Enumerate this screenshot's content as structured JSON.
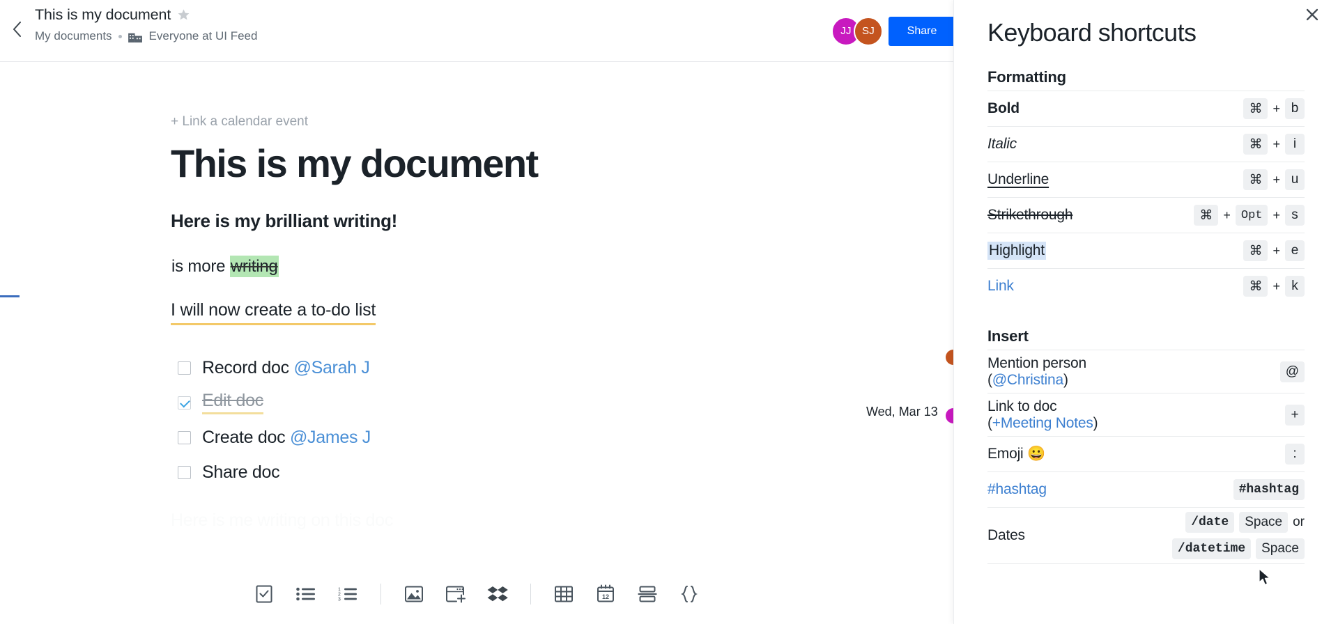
{
  "header": {
    "back_icon": "chevron-left-icon",
    "doc_title": "This is my document",
    "star_icon": "star-icon",
    "breadcrumb_parent": "My documents",
    "org_icon": "office-building-icon",
    "org_name": "Everyone at UI Feed",
    "avatars": [
      {
        "initials": "JJ",
        "color": "#c819bf"
      },
      {
        "initials": "SJ",
        "color": "#c4541f"
      }
    ],
    "share_label": "Share",
    "share_color": "#0061fe"
  },
  "document": {
    "calendar_link": "+ Link a calendar event",
    "heading": "This is my document",
    "subheading": "Here is my brilliant writing!",
    "paragraph_prefix": "is more ",
    "paragraph_highlight": "writing",
    "highlight_color": "#b3e6b3",
    "todo_intro": "I will now create a to-do list",
    "todos": [
      {
        "text": "Record doc ",
        "mention": "@Sarah J",
        "checked": false
      },
      {
        "text": "Edit doc",
        "mention": "",
        "checked": true
      },
      {
        "text": "Create doc ",
        "mention": "@James J",
        "checked": false
      },
      {
        "text": "Share doc",
        "mention": "",
        "checked": false
      }
    ],
    "placeholder": "Here is me writing on this doc",
    "date_label": "Wed, Mar 13"
  },
  "toolbar": {
    "items": [
      {
        "name": "checklist-icon",
        "type": "icon"
      },
      {
        "name": "bulleted-list-icon",
        "type": "icon"
      },
      {
        "name": "numbered-list-icon",
        "type": "icon"
      },
      {
        "name": "toolbar-divider",
        "type": "sep"
      },
      {
        "name": "image-icon",
        "type": "icon"
      },
      {
        "name": "embed-icon",
        "type": "icon"
      },
      {
        "name": "dropbox-icon",
        "type": "icon"
      },
      {
        "name": "toolbar-divider",
        "type": "sep"
      },
      {
        "name": "table-icon",
        "type": "icon"
      },
      {
        "name": "calendar-icon",
        "type": "icon"
      },
      {
        "name": "horizontal-rule-icon",
        "type": "icon"
      },
      {
        "name": "code-block-icon",
        "type": "icon"
      }
    ],
    "calendar_day": "12",
    "numbered_list_digits": [
      "1",
      "2",
      "3"
    ]
  },
  "shortcuts_panel": {
    "title": "Keyboard shortcuts",
    "close_icon": "close-icon",
    "sections": [
      {
        "name": "Formatting",
        "rows": [
          {
            "label": "Bold",
            "style": "bold",
            "keys": [
              "⌘",
              "+",
              "b"
            ]
          },
          {
            "label": "Italic",
            "style": "italic",
            "keys": [
              "⌘",
              "+",
              "i"
            ]
          },
          {
            "label": "Underline",
            "style": "underline",
            "keys": [
              "⌘",
              "+",
              "u"
            ]
          },
          {
            "label": "Strikethrough",
            "style": "strike",
            "keys": [
              "⌘",
              "+",
              "Opt",
              "+",
              "s"
            ]
          },
          {
            "label": "Highlight",
            "style": "hl",
            "keys": [
              "⌘",
              "+",
              "e"
            ]
          },
          {
            "label": "Link",
            "style": "linkcolor",
            "keys": [
              "⌘",
              "+",
              "k"
            ]
          }
        ]
      },
      {
        "name": "Insert",
        "rows": [
          {
            "label": "Mention person",
            "sub_open": "(",
            "sub": "@Christina",
            "sub_close": ")",
            "keys": [
              "@"
            ]
          },
          {
            "label": "Link to doc",
            "sub_open": "(",
            "sub": "+Meeting Notes",
            "sub_close": ")",
            "keys": [
              "+"
            ]
          },
          {
            "label": "Emoji 😀",
            "keys": [
              ":"
            ]
          },
          {
            "label": "#hashtag",
            "style": "linkcolor",
            "keys": [
              "#hashtag"
            ]
          },
          {
            "label": "Dates",
            "keys_line1": [
              "/date",
              "Space"
            ],
            "or": "or",
            "keys_line2": [
              "/datetime",
              "Space"
            ]
          }
        ]
      }
    ]
  }
}
